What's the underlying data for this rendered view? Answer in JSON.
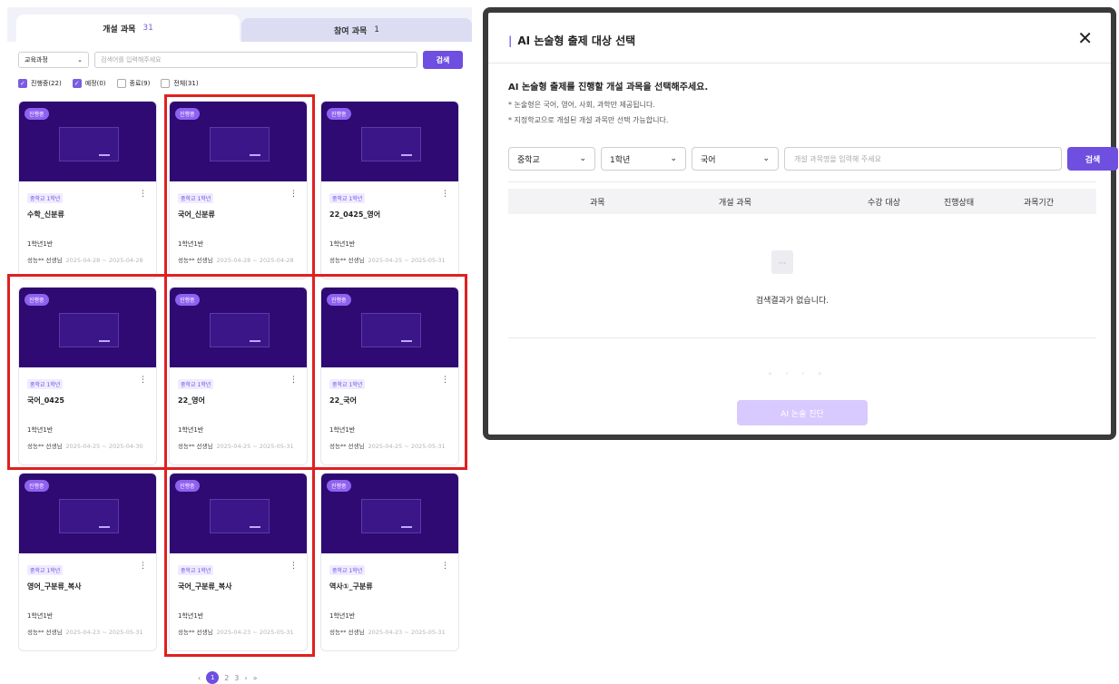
{
  "left": {
    "tabs": [
      {
        "label": "개설 과목",
        "count": "31"
      },
      {
        "label": "참여 과목",
        "count": "1"
      }
    ],
    "filter": {
      "select_value": "교육과정",
      "search_placeholder": "검색어를 입력해주세요",
      "search_button": "검색"
    },
    "checks": [
      {
        "label": "진행중(22)",
        "checked": true
      },
      {
        "label": "예정(0)",
        "checked": true
      },
      {
        "label": "종료(9)",
        "checked": false
      },
      {
        "label": "전체(31)",
        "checked": false
      }
    ],
    "cards": [
      {
        "badge": "진행중",
        "grade": "중학교 1학년",
        "title": "수학_신분류",
        "class": "1학년1반",
        "teacher": "성능** 선생님",
        "date": "2025-04-28 ~ 2025-04-28"
      },
      {
        "badge": "진행중",
        "grade": "중학교 1학년",
        "title": "국어_신분류",
        "class": "1학년1반",
        "teacher": "성능** 선생님",
        "date": "2025-04-28 ~ 2025-04-28"
      },
      {
        "badge": "진행중",
        "grade": "중학교 1학년",
        "title": "22_0425_영어",
        "class": "1학년1반",
        "teacher": "성능** 선생님",
        "date": "2025-04-25 ~ 2025-05-31"
      },
      {
        "badge": "진행중",
        "grade": "중학교 1학년",
        "title": "국어_0425",
        "class": "1학년1반",
        "teacher": "성능** 선생님",
        "date": "2025-04-25 ~ 2025-04-30"
      },
      {
        "badge": "진행중",
        "grade": "중학교 1학년",
        "title": "22_영어",
        "class": "1학년1반",
        "teacher": "성능** 선생님",
        "date": "2025-04-25 ~ 2025-05-31"
      },
      {
        "badge": "진행중",
        "grade": "중학교 1학년",
        "title": "22_국어",
        "class": "1학년1반",
        "teacher": "성능** 선생님",
        "date": "2025-04-25 ~ 2025-05-31"
      },
      {
        "badge": "진행중",
        "grade": "중학교 1학년",
        "title": "영어_구분류_복사",
        "class": "1학년1반",
        "teacher": "성능** 선생님",
        "date": "2025-04-23 ~ 2025-05-31"
      },
      {
        "badge": "진행중",
        "grade": "중학교 1학년",
        "title": "국어_구분류_복사",
        "class": "1학년1반",
        "teacher": "성능** 선생님",
        "date": "2025-04-23 ~ 2025-05-31"
      },
      {
        "badge": "진행중",
        "grade": "중학교 1학년",
        "title": "역사①_구분류",
        "class": "1학년1반",
        "teacher": "성능** 선생님",
        "date": "2025-04-23 ~ 2025-05-31"
      }
    ],
    "pager": {
      "prev": "‹",
      "pages": [
        "1",
        "2",
        "3"
      ],
      "next": "›",
      "last": "»"
    }
  },
  "modal": {
    "title": "AI 논술형 출제 대상 선택",
    "pipe": "|",
    "close": "✕",
    "lead": "AI 논술형 출제를 진행할 개설 과목을 선택해주세요.",
    "note1": "* 논술형은 국어, 영어, 사회, 과학만 제공됩니다.",
    "note2": "* 지정학교으로 개설된 개설 과목만 선택 가능합니다.",
    "filters": {
      "school": "중학교",
      "grade": "1학년",
      "subject": "국어",
      "search_placeholder": "개설 과목명을 입력해 주세요",
      "search_button": "검색"
    },
    "columns": [
      "과목",
      "개설 과목",
      "수강 대상",
      "진행상태",
      "과목기간"
    ],
    "empty_text": "검색결과가 없습니다.",
    "pager_text": "« ‹ › »",
    "cta": "AI 논술 진단"
  },
  "colors": {
    "accent": "#6e4fe0",
    "highlight": "#e02020",
    "thumb": "#2e0a72"
  }
}
